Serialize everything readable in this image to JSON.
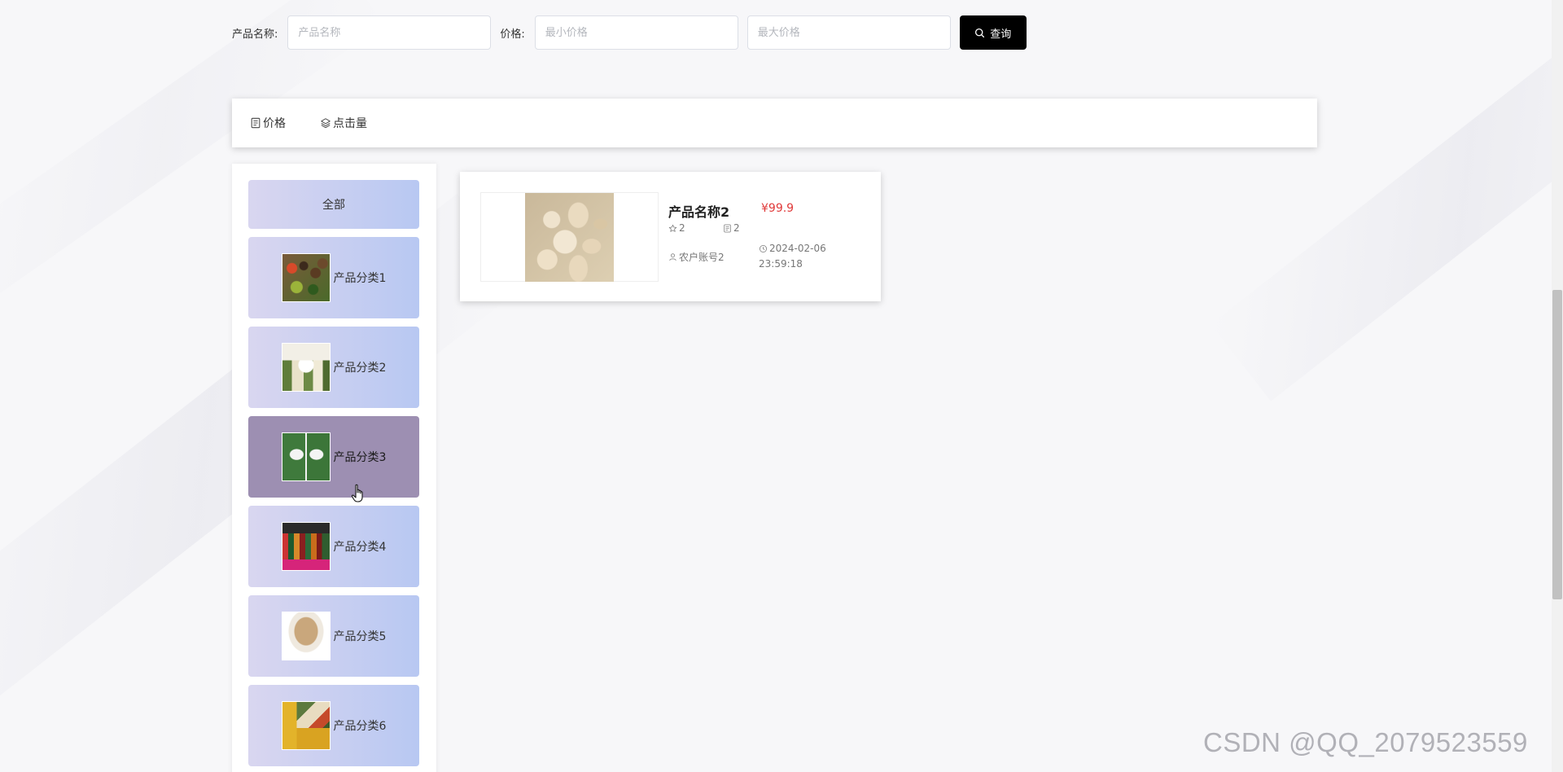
{
  "search": {
    "name_label": "产品名称:",
    "name_placeholder": "产品名称",
    "price_label": "价格:",
    "min_placeholder": "最小价格",
    "max_placeholder": "最大价格",
    "query_label": "查询",
    "query_icon": "search-icon"
  },
  "sort": {
    "items": [
      {
        "label": "价格",
        "icon": "document-icon"
      },
      {
        "label": "点击量",
        "icon": "layers-icon"
      }
    ]
  },
  "categories": {
    "all_label": "全部",
    "items": [
      {
        "label": "产品分类1",
        "active": false
      },
      {
        "label": "产品分类2",
        "active": false
      },
      {
        "label": "产品分类3",
        "active": true
      },
      {
        "label": "产品分类4",
        "active": false
      },
      {
        "label": "产品分类5",
        "active": false
      },
      {
        "label": "产品分类6",
        "active": false
      }
    ]
  },
  "products": [
    {
      "name": "产品名称2",
      "price": "¥99.9",
      "favorites": "2",
      "comments": "2",
      "owner": "农户账号2",
      "time_date": "2024-02-06",
      "time_clock": "23:59:18"
    }
  ],
  "watermark": "CSDN @QQ_2079523559",
  "colors": {
    "accent": "#000000",
    "price": "#e03a3a",
    "category_active": "#9d8fb2",
    "category_gradient_start": "#d9d6f0",
    "category_gradient_end": "#b8c8f2"
  }
}
